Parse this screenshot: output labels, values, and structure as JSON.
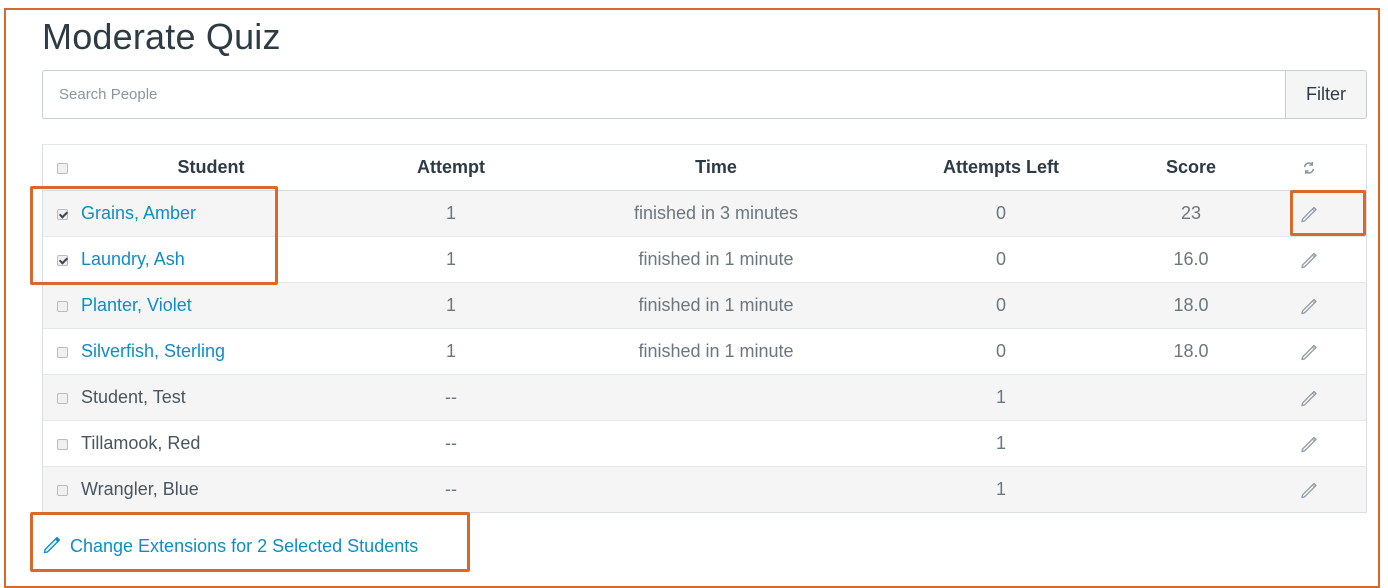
{
  "page": {
    "title": "Moderate Quiz"
  },
  "search": {
    "placeholder": "Search People",
    "filter_label": "Filter"
  },
  "table": {
    "headers": {
      "student": "Student",
      "attempt": "Attempt",
      "time": "Time",
      "attempts_left": "Attempts Left",
      "score": "Score"
    },
    "rows": [
      {
        "student": "Grains, Amber",
        "checked": true,
        "linked": true,
        "attempt": "1",
        "time": "finished in 3 minutes",
        "attempts_left": "0",
        "score": "23"
      },
      {
        "student": "Laundry, Ash",
        "checked": true,
        "linked": true,
        "attempt": "1",
        "time": "finished in 1 minute",
        "attempts_left": "0",
        "score": "16.0"
      },
      {
        "student": "Planter, Violet",
        "checked": false,
        "linked": true,
        "attempt": "1",
        "time": "finished in 1 minute",
        "attempts_left": "0",
        "score": "18.0"
      },
      {
        "student": "Silverfish, Sterling",
        "checked": false,
        "linked": true,
        "attempt": "1",
        "time": "finished in 1 minute",
        "attempts_left": "0",
        "score": "18.0"
      },
      {
        "student": "Student, Test",
        "checked": false,
        "linked": false,
        "attempt": "--",
        "time": "",
        "attempts_left": "1",
        "score": ""
      },
      {
        "student": "Tillamook, Red",
        "checked": false,
        "linked": false,
        "attempt": "--",
        "time": "",
        "attempts_left": "1",
        "score": ""
      },
      {
        "student": "Wrangler, Blue",
        "checked": false,
        "linked": false,
        "attempt": "--",
        "time": "",
        "attempts_left": "1",
        "score": ""
      }
    ]
  },
  "footer": {
    "extension_link": "Change Extensions for 2 Selected Students"
  },
  "icons": {
    "header_refresh": "refresh-icon",
    "row_edit": "pencil-icon",
    "extension": "pencil-icon"
  },
  "colors": {
    "accent_link": "#0f8dc7",
    "highlight_border": "#d9682b",
    "zebra": "#f5f5f5"
  }
}
